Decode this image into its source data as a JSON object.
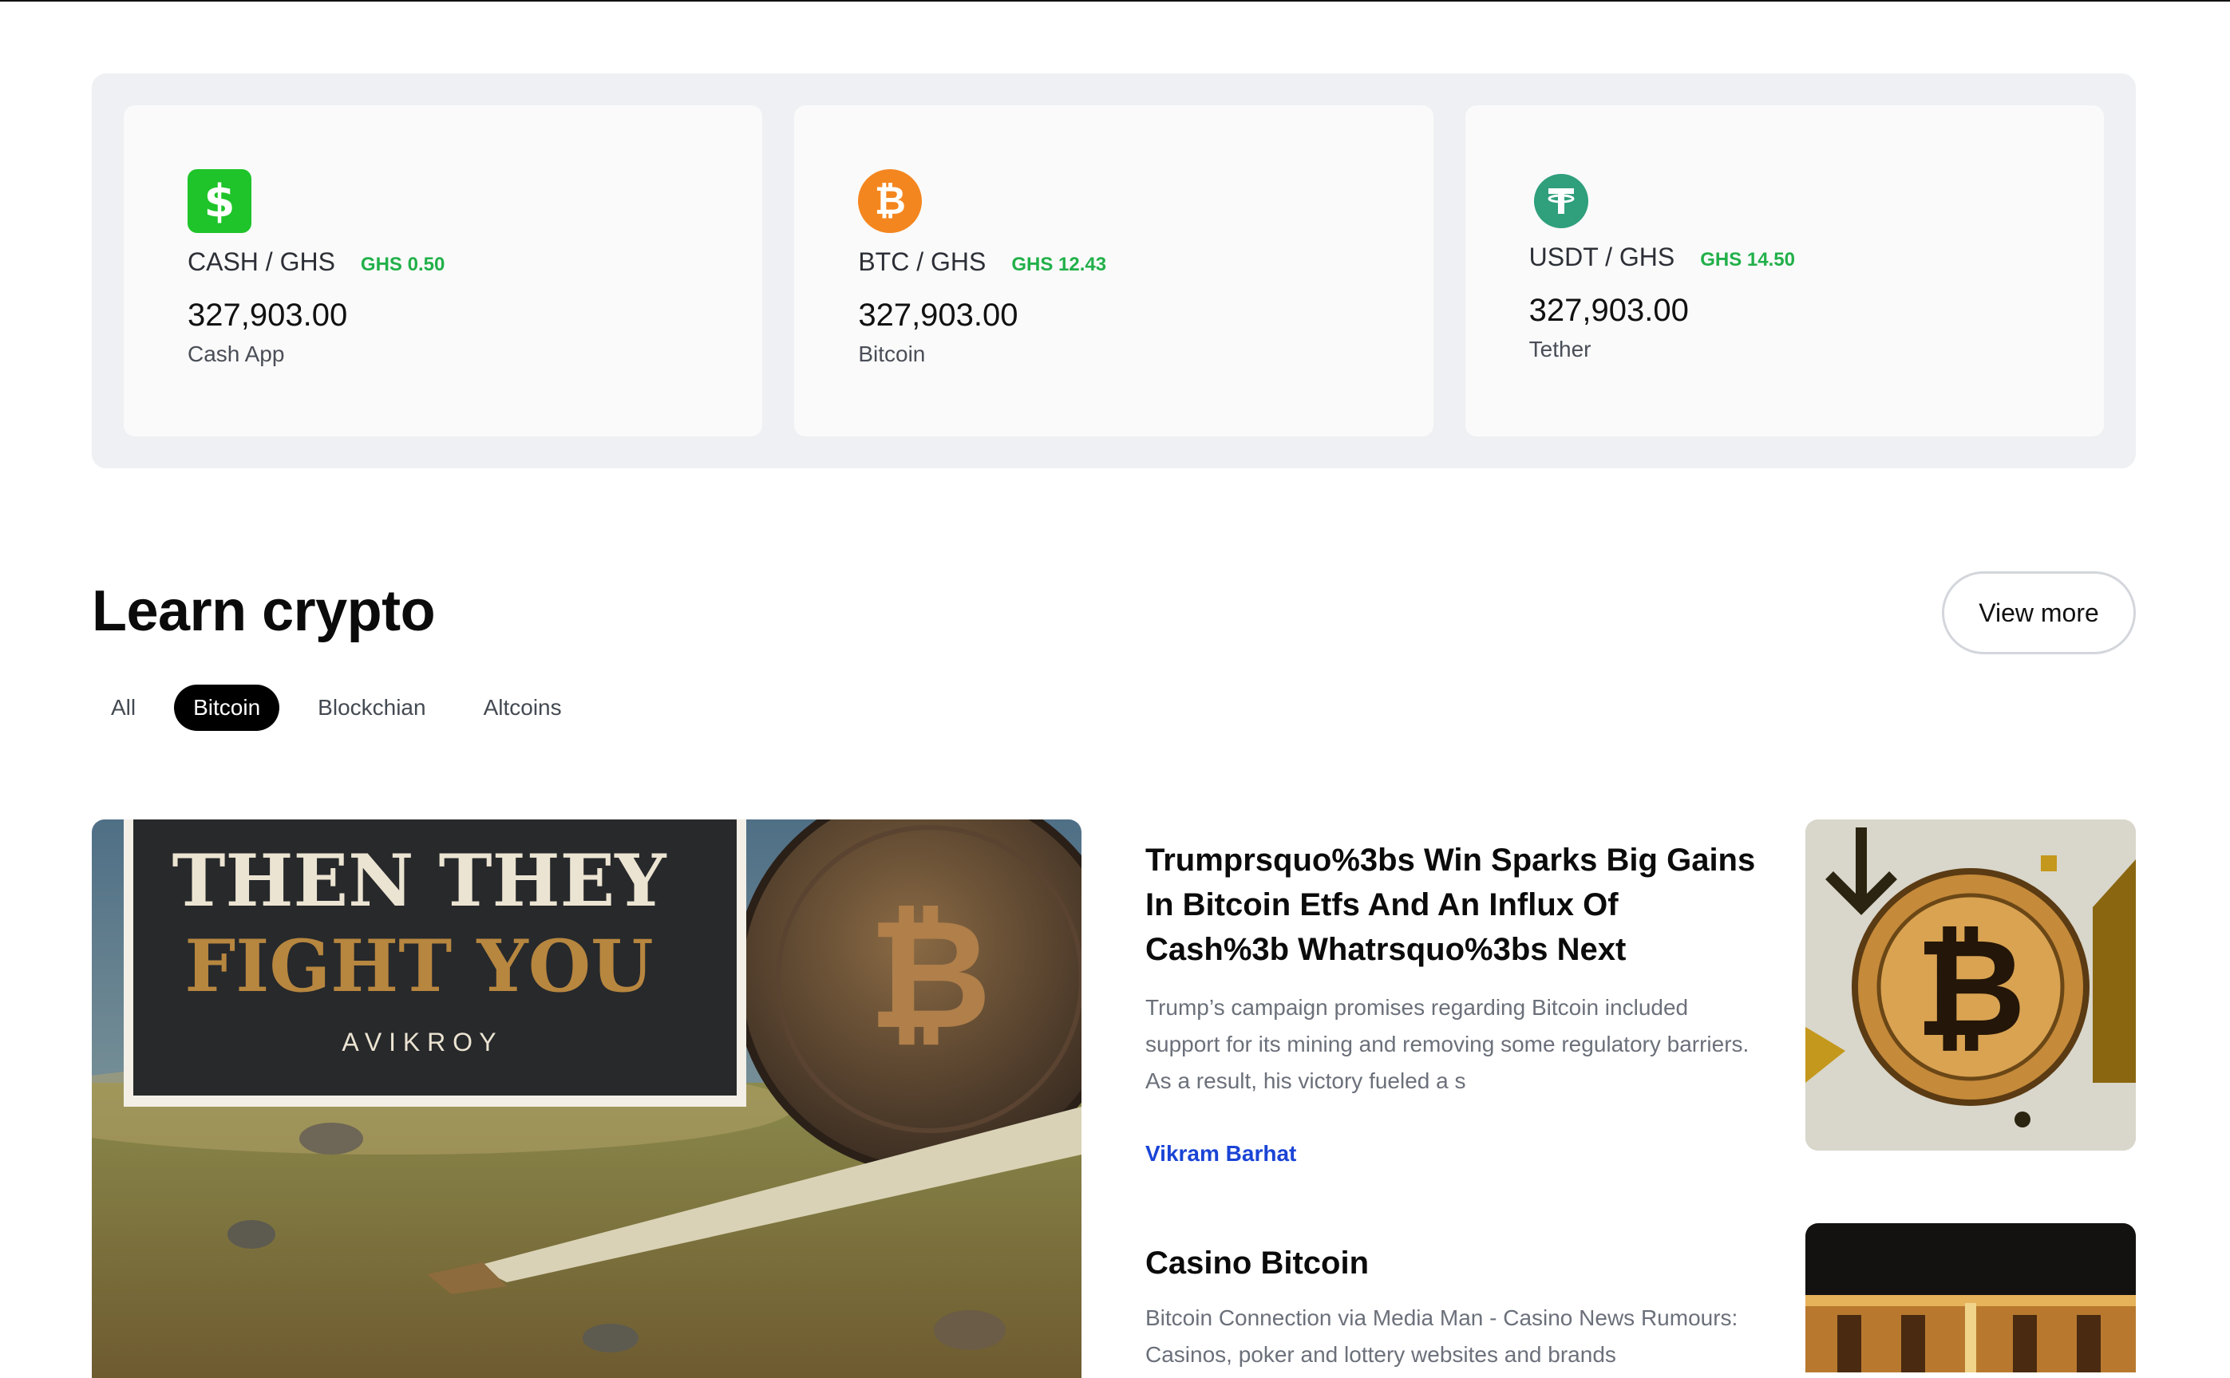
{
  "rates": [
    {
      "icon": "cash-app-icon",
      "pair": "CASH / GHS",
      "delta": "GHS 0.50",
      "amount": "327,903.00",
      "name": "Cash App",
      "color": "#1fc42a"
    },
    {
      "icon": "bitcoin-icon",
      "pair": "BTC / GHS",
      "delta": "GHS 12.43",
      "amount": "327,903.00",
      "name": "Bitcoin",
      "color": "#f4861f"
    },
    {
      "icon": "tether-icon",
      "pair": "USDT / GHS",
      "delta": "GHS 14.50",
      "amount": "327,903.00",
      "name": "Tether",
      "color": "#2f9f7c"
    }
  ],
  "learn": {
    "title": "Learn crypto",
    "view_more": "View more",
    "filters": [
      "All",
      "Bitcoin",
      "Blockchian",
      "Altcoins"
    ],
    "active_filter": "Bitcoin",
    "feature_image": {
      "line1": "THEN THEY",
      "line2": "FIGHT YOU",
      "author": "A V I K   R O Y"
    },
    "articles": [
      {
        "title": "Trumprsquo%3bs Win Sparks Big Gains In Bitcoin Etfs And An Influx Of Cash%3b Whatrsquo%3bs Next",
        "excerpt": "Trump’s campaign promises regarding Bitcoin included support for its mining and removing some regulatory barriers. As a result, his victory fueled a s",
        "author": "Vikram Barhat"
      },
      {
        "title": "Casino Bitcoin",
        "excerpt": "Bitcoin Connection via Media Man - Casino News Rumours: Casinos, poker and lottery websites and brands"
      }
    ]
  }
}
